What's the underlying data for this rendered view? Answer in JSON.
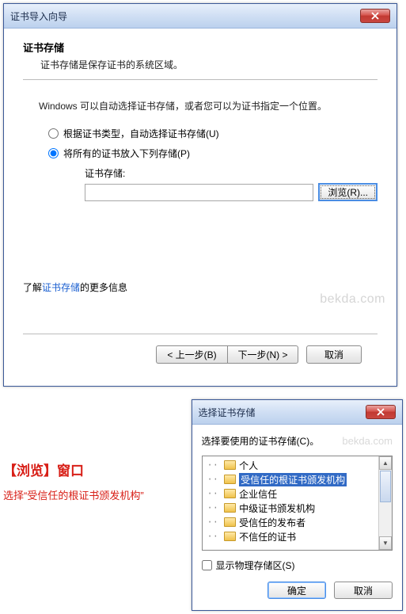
{
  "window1": {
    "title": "证书导入向导",
    "heading": "证书存储",
    "subheading": "证书存储是保存证书的系统区域。",
    "instruction": "Windows 可以自动选择证书存储，或者您可以为证书指定一个位置。",
    "radio1": "根据证书类型，自动选择证书存储(U)",
    "radio2": "将所有的证书放入下列存储(P)",
    "store_label": "证书存储:",
    "store_value": "",
    "browse": "浏览(R)...",
    "learn_prefix": "了解",
    "learn_link": "证书存储",
    "learn_suffix": "的更多信息",
    "watermark": "bekda.com",
    "back": "< 上一步(B)",
    "next": "下一步(N) >",
    "cancel": "取消"
  },
  "annotation": {
    "title": "【浏览】窗口",
    "sub": "选择“受信任的根证书颁发机构”"
  },
  "window2": {
    "title": "选择证书存储",
    "label": "选择要使用的证书存储(C)。",
    "watermark": "bekda.com",
    "items": [
      "个人",
      "受信任的根证书颁发机构",
      "企业信任",
      "中级证书颁发机构",
      "受信任的发布者",
      "不信任的证书"
    ],
    "selected_index": 1,
    "show_physical": "显示物理存储区(S)",
    "ok": "确定",
    "cancel": "取消"
  }
}
